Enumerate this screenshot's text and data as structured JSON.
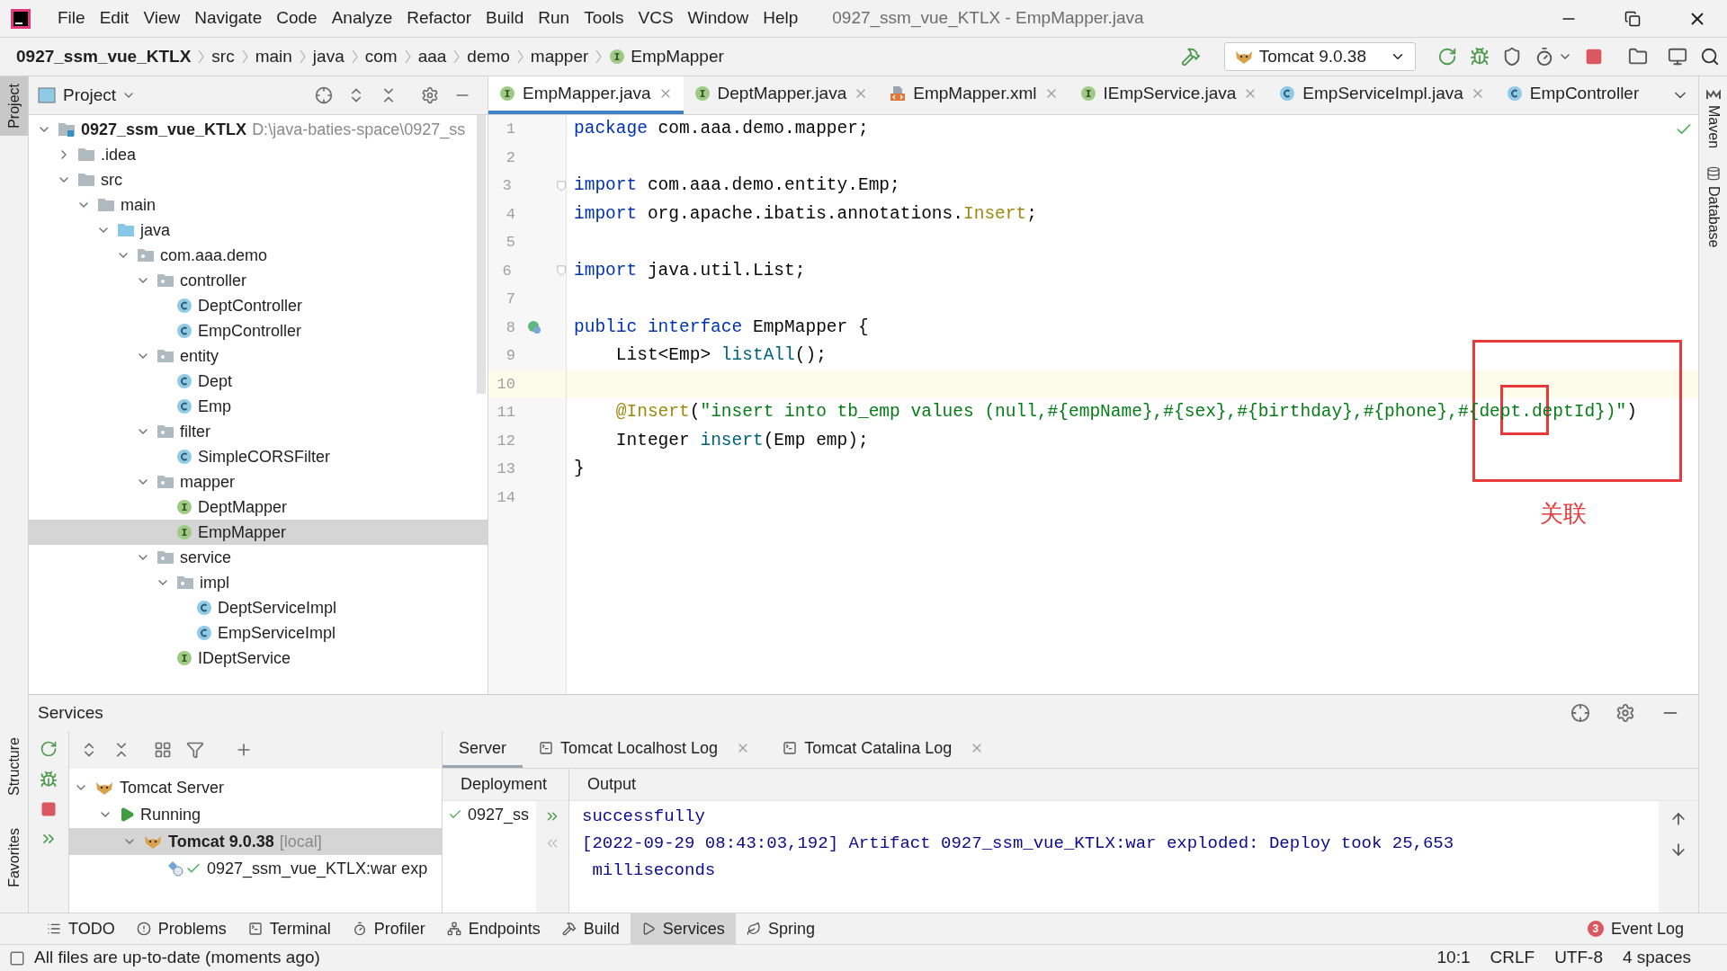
{
  "app_menu": [
    "File",
    "Edit",
    "View",
    "Navigate",
    "Code",
    "Analyze",
    "Refactor",
    "Build",
    "Run",
    "Tools",
    "VCS",
    "Window",
    "Help"
  ],
  "window": {
    "title": "0927_ssm_vue_KTLX - EmpMapper.java"
  },
  "breadcrumbs": [
    {
      "label": "0927_ssm_vue_KTLX",
      "kind": "project"
    },
    {
      "label": "src",
      "kind": "folder"
    },
    {
      "label": "main",
      "kind": "folder"
    },
    {
      "label": "java",
      "kind": "folder"
    },
    {
      "label": "com",
      "kind": "folder"
    },
    {
      "label": "aaa",
      "kind": "folder"
    },
    {
      "label": "demo",
      "kind": "folder"
    },
    {
      "label": "mapper",
      "kind": "folder"
    },
    {
      "label": "EmpMapper",
      "kind": "interface"
    }
  ],
  "run_config": {
    "label": "Tomcat 9.0.38"
  },
  "left_stripe": [
    {
      "label": "Project",
      "selected": true,
      "kind": "top"
    },
    {
      "label": "Structure",
      "selected": false,
      "kind": "bottom"
    },
    {
      "label": "Favorites",
      "selected": false,
      "kind": "bottom"
    }
  ],
  "project_panel": {
    "title": "Project",
    "tree": [
      {
        "label": "0927_ssm_vue_KTLX",
        "path": "D:\\java-baties-space\\0927_ss",
        "kind": "project",
        "expanded": true,
        "selected": false,
        "children": [
          {
            "label": ".idea",
            "kind": "folder",
            "expanded": false,
            "selected": false
          },
          {
            "label": "src",
            "kind": "folder",
            "expanded": true,
            "selected": false,
            "children": [
              {
                "label": "main",
                "kind": "folder",
                "expanded": true,
                "selected": false,
                "children": [
                  {
                    "label": "java",
                    "kind": "source",
                    "expanded": true,
                    "selected": false,
                    "children": [
                      {
                        "label": "com.aaa.demo",
                        "kind": "package",
                        "expanded": true,
                        "selected": false,
                        "children": [
                          {
                            "label": "controller",
                            "kind": "package",
                            "expanded": true,
                            "selected": false,
                            "children": [
                              {
                                "label": "DeptController",
                                "kind": "class",
                                "selected": false
                              },
                              {
                                "label": "EmpController",
                                "kind": "class",
                                "selected": false
                              }
                            ]
                          },
                          {
                            "label": "entity",
                            "kind": "package",
                            "expanded": true,
                            "selected": false,
                            "children": [
                              {
                                "label": "Dept",
                                "kind": "class",
                                "selected": false
                              },
                              {
                                "label": "Emp",
                                "kind": "class",
                                "selected": false
                              }
                            ]
                          },
                          {
                            "label": "filter",
                            "kind": "package",
                            "expanded": true,
                            "selected": false,
                            "children": [
                              {
                                "label": "SimpleCORSFilter",
                                "kind": "class",
                                "selected": false
                              }
                            ]
                          },
                          {
                            "label": "mapper",
                            "kind": "package",
                            "expanded": true,
                            "selected": false,
                            "children": [
                              {
                                "label": "DeptMapper",
                                "kind": "interface",
                                "selected": false
                              },
                              {
                                "label": "EmpMapper",
                                "kind": "interface",
                                "selected": true
                              }
                            ]
                          },
                          {
                            "label": "service",
                            "kind": "package",
                            "expanded": true,
                            "selected": false,
                            "children": [
                              {
                                "label": "impl",
                                "kind": "package",
                                "expanded": true,
                                "selected": false,
                                "children": [
                                  {
                                    "label": "DeptServiceImpl",
                                    "kind": "class",
                                    "selected": false
                                  },
                                  {
                                    "label": "EmpServiceImpl",
                                    "kind": "class",
                                    "selected": false
                                  }
                                ]
                              },
                              {
                                "label": "IDeptService",
                                "kind": "interface",
                                "selected": false
                              }
                            ]
                          }
                        ]
                      }
                    ]
                  }
                ]
              }
            ]
          }
        ]
      }
    ]
  },
  "editor": {
    "tabs": [
      {
        "label": "EmpMapper.java",
        "kind": "interface",
        "selected": true,
        "closable": true
      },
      {
        "label": "DeptMapper.java",
        "kind": "interface",
        "selected": false,
        "closable": true
      },
      {
        "label": "EmpMapper.xml",
        "kind": "xml",
        "selected": false,
        "closable": true
      },
      {
        "label": "IEmpService.java",
        "kind": "interface",
        "selected": false,
        "closable": true
      },
      {
        "label": "EmpServiceImpl.java",
        "kind": "class",
        "selected": false,
        "closable": true
      },
      {
        "label": "EmpController",
        "kind": "class",
        "selected": false,
        "closable": false
      }
    ],
    "lines": [
      {
        "number": "1",
        "current": false,
        "tokens": [
          {
            "text": "package",
            "kind": "keyword"
          },
          {
            "text": " com.aaa.demo.mapper;",
            "kind": "plain"
          }
        ]
      },
      {
        "number": "2",
        "current": false
      },
      {
        "number": "3",
        "current": false,
        "fold": true,
        "tokens": [
          {
            "text": "import",
            "kind": "keyword"
          },
          {
            "text": " com.aaa.demo.entity.Emp;",
            "kind": "plain"
          }
        ]
      },
      {
        "number": "4",
        "current": false,
        "tokens": [
          {
            "text": "import",
            "kind": "keyword"
          },
          {
            "text": " org.apache.ibatis.annotations.",
            "kind": "plain"
          },
          {
            "text": "Insert",
            "kind": "annotation"
          },
          {
            "text": ";",
            "kind": "plain"
          }
        ]
      },
      {
        "number": "5",
        "current": false
      },
      {
        "number": "6",
        "current": false,
        "fold": true,
        "tokens": [
          {
            "text": "import",
            "kind": "keyword"
          },
          {
            "text": " java.util.List;",
            "kind": "plain"
          }
        ]
      },
      {
        "number": "7",
        "current": false
      },
      {
        "number": "8",
        "current": false,
        "implemented": true,
        "tokens": [
          {
            "text": "public interface",
            "kind": "keyword"
          },
          {
            "text": " EmpMapper {",
            "kind": "plain"
          }
        ]
      },
      {
        "number": "9",
        "current": false,
        "tokens": [
          {
            "text": "    List<Emp> ",
            "kind": "plain"
          },
          {
            "text": "listAll",
            "kind": "method"
          },
          {
            "text": "();",
            "kind": "plain"
          }
        ]
      },
      {
        "number": "10",
        "current": true
      },
      {
        "number": "11",
        "current": false,
        "tokens": [
          {
            "text": "    @Insert",
            "kind": "annotation"
          },
          {
            "text": "(",
            "kind": "plain"
          },
          {
            "text": "\"insert into tb_emp values (null,#{empName},#{sex},#{birthday},#{phone},#{dept.deptId})\"",
            "kind": "string"
          },
          {
            "text": ")",
            "kind": "plain"
          }
        ]
      },
      {
        "number": "12",
        "current": false,
        "tokens": [
          {
            "text": "    Integer ",
            "kind": "plain"
          },
          {
            "text": "insert",
            "kind": "method"
          },
          {
            "text": "(Emp emp);",
            "kind": "plain"
          }
        ]
      },
      {
        "number": "13",
        "current": false,
        "tokens": [
          {
            "text": "}",
            "kind": "plain"
          }
        ]
      },
      {
        "number": "14",
        "current": false
      }
    ],
    "annotation": {
      "label": "关联"
    }
  },
  "right_stripe": [
    {
      "label": "Maven",
      "kind": "maven"
    },
    {
      "label": "Database",
      "kind": "database"
    }
  ],
  "services": {
    "title": "Services",
    "tree": [
      {
        "label": "Tomcat Server",
        "kind": "server",
        "expanded": true,
        "selected": false,
        "children": [
          {
            "label": "Running",
            "kind": "running",
            "expanded": true,
            "selected": false,
            "children": [
              {
                "label": "Tomcat 9.0.38",
                "suffix": "[local]",
                "kind": "tomcat",
                "expanded": true,
                "selected": true,
                "children": [
                  {
                    "label": "0927_ssm_vue_KTLX:war exp",
                    "kind": "artifact",
                    "selected": false
                  }
                ]
              }
            ]
          }
        ]
      }
    ],
    "tabs": [
      {
        "label": "Server",
        "selected": true,
        "closable": false
      },
      {
        "label": "Tomcat Localhost Log",
        "selected": false,
        "closable": true
      },
      {
        "label": "Tomcat Catalina Log",
        "selected": false,
        "closable": true
      }
    ],
    "deployment": {
      "header": "Deployment",
      "items": [
        "0927_ss"
      ]
    },
    "output": {
      "header": "Output",
      "lines": [
        "successfully",
        "[2022-09-29 08:43:03,192] Artifact 0927_ssm_vue_KTLX:war exploded: Deploy took 25,653",
        " milliseconds"
      ]
    }
  },
  "tool_tabs": [
    {
      "label": "TODO",
      "kind": "todo",
      "selected": false
    },
    {
      "label": "Problems",
      "kind": "problems",
      "selected": false
    },
    {
      "label": "Terminal",
      "kind": "terminal",
      "selected": false
    },
    {
      "label": "Profiler",
      "kind": "profiler",
      "selected": false
    },
    {
      "label": "Endpoints",
      "kind": "endpoints",
      "selected": false
    },
    {
      "label": "Build",
      "kind": "build",
      "selected": false
    },
    {
      "label": "Services",
      "kind": "services",
      "selected": true
    },
    {
      "label": "Spring",
      "kind": "spring",
      "selected": false
    }
  ],
  "event_log": {
    "label": "Event Log",
    "count": "3"
  },
  "status_bar": {
    "message": "All files are up-to-date (moments ago)",
    "items": [
      "10:1",
      "CRLF",
      "UTF-8",
      "4 spaces"
    ]
  }
}
